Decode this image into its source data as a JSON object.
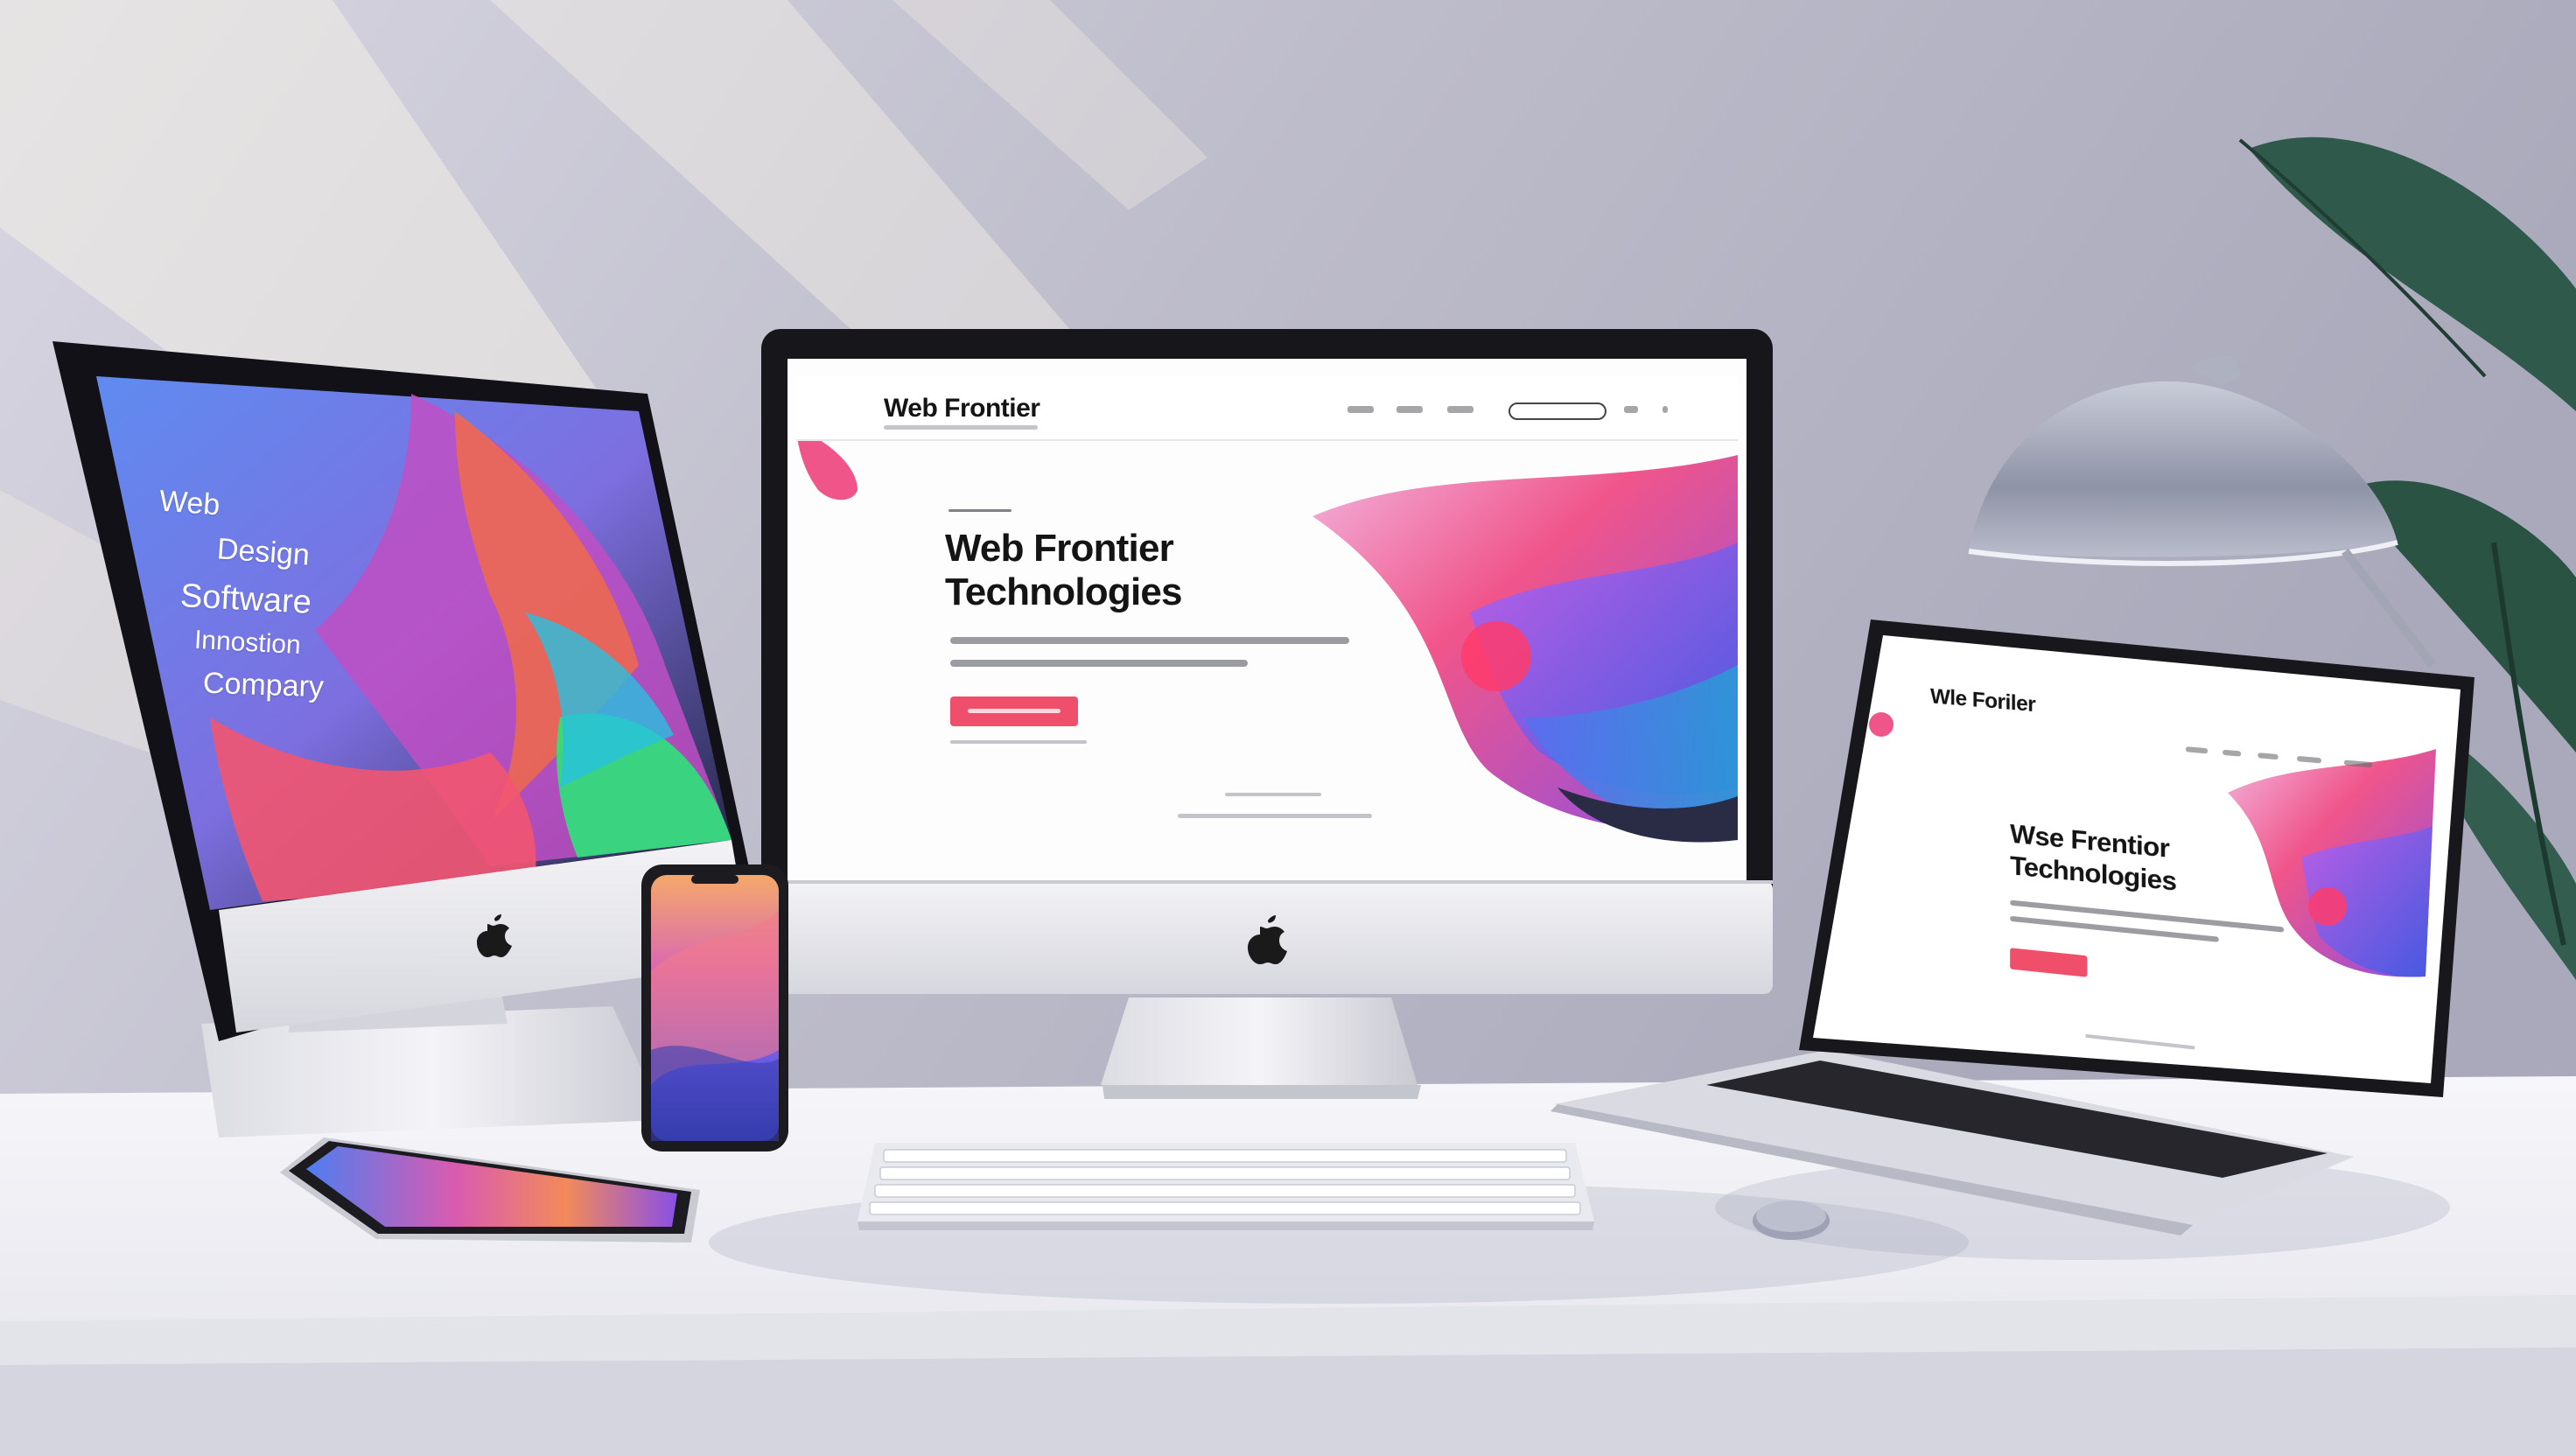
{
  "left_imac": {
    "words": [
      "Web",
      "Design",
      "Software",
      "Innostion",
      "Compary"
    ]
  },
  "center_monitor": {
    "logo": "Web Frontier",
    "headline_line1": "Web Frontier",
    "headline_line2": "Technologies"
  },
  "laptop": {
    "logo": "Wle Foriler",
    "headline_line1": "Wse Frentior",
    "headline_line2": "Technologies"
  },
  "colors": {
    "wall": "#b4b4c4",
    "desk": "#f2f2f6",
    "accent_pink": "#ef4f6b",
    "accent_purple": "#8a4fe6",
    "accent_blue": "#3f6fe6",
    "plant": "#2f5a4b"
  }
}
